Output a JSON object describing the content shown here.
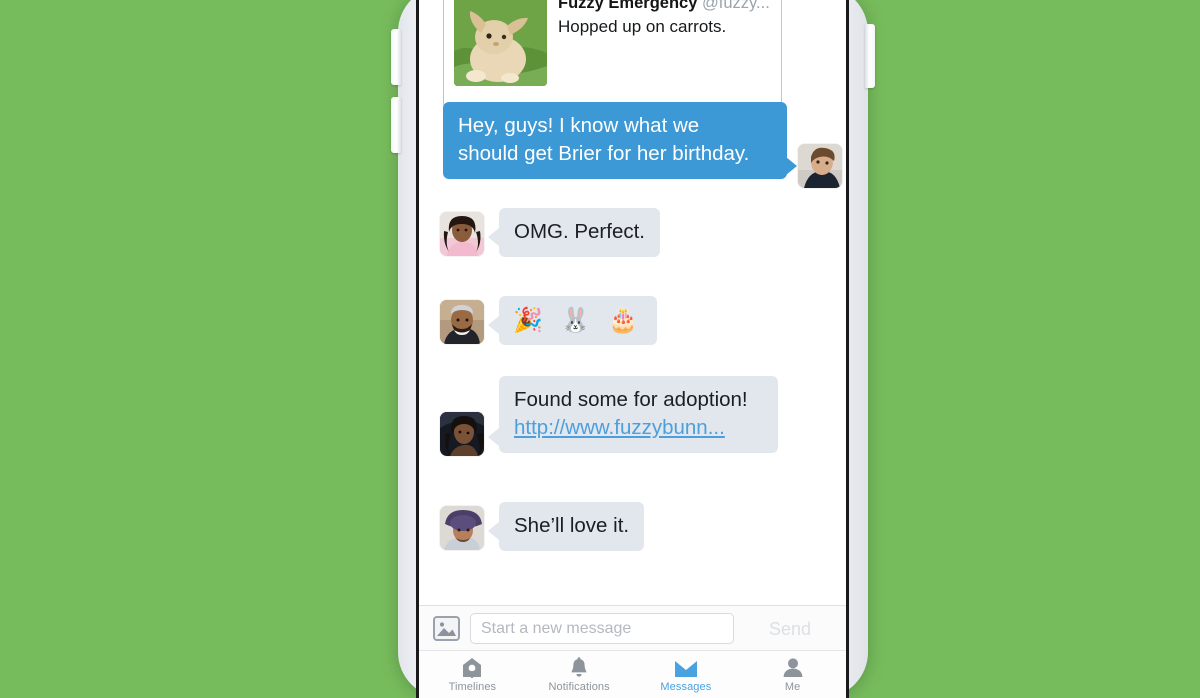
{
  "theme": {
    "background_green": "#77bc5c",
    "accent_blue": "#3d98d6",
    "link_blue": "#4a9fdc",
    "them_bubble_gray": "#e2e6ed",
    "active_tab_blue": "#4aa3e0"
  },
  "attachment_card": {
    "author_name": "Fuzzy Emergency",
    "author_handle": "@fuzzy...",
    "text": "Hopped up on carrots.",
    "photo_alt": "bunny-photo"
  },
  "messages": [
    {
      "id": "msg-1",
      "side": "outgoing",
      "text": "Hey, guys! I know what we\nshould get Brier for her birthday.",
      "avatar_alt": "avatar-sender-self"
    },
    {
      "id": "msg-2",
      "side": "incoming",
      "text": "OMG. Perfect.",
      "avatar_alt": "avatar-woman-pink"
    },
    {
      "id": "msg-3",
      "side": "incoming",
      "text": "🎉 🐰 🎂",
      "is_emoji": true,
      "avatar_alt": "avatar-man-beanie"
    },
    {
      "id": "msg-4",
      "side": "incoming",
      "text": "Found some for adoption!",
      "link": "http://www.fuzzybunn...",
      "avatar_alt": "avatar-woman-curly"
    },
    {
      "id": "msg-5",
      "side": "incoming",
      "text": "She’ll love it.",
      "avatar_alt": "avatar-man-hat"
    }
  ],
  "composer": {
    "attach_icon": "photo-icon",
    "input_value": "",
    "input_placeholder": "Start a new message",
    "send_label": "Send"
  },
  "tabbar": {
    "items": [
      {
        "label": "Timelines",
        "icon": "birdhouse-icon",
        "active": false
      },
      {
        "label": "Notifications",
        "icon": "bell-icon",
        "active": false
      },
      {
        "label": "Messages",
        "icon": "envelope-icon",
        "active": true
      },
      {
        "label": "Me",
        "icon": "person-icon",
        "active": false
      }
    ]
  },
  "device": {
    "volume_up_button": "volume-up-button",
    "volume_down_button": "volume-down-button",
    "power_button": "power-button"
  }
}
